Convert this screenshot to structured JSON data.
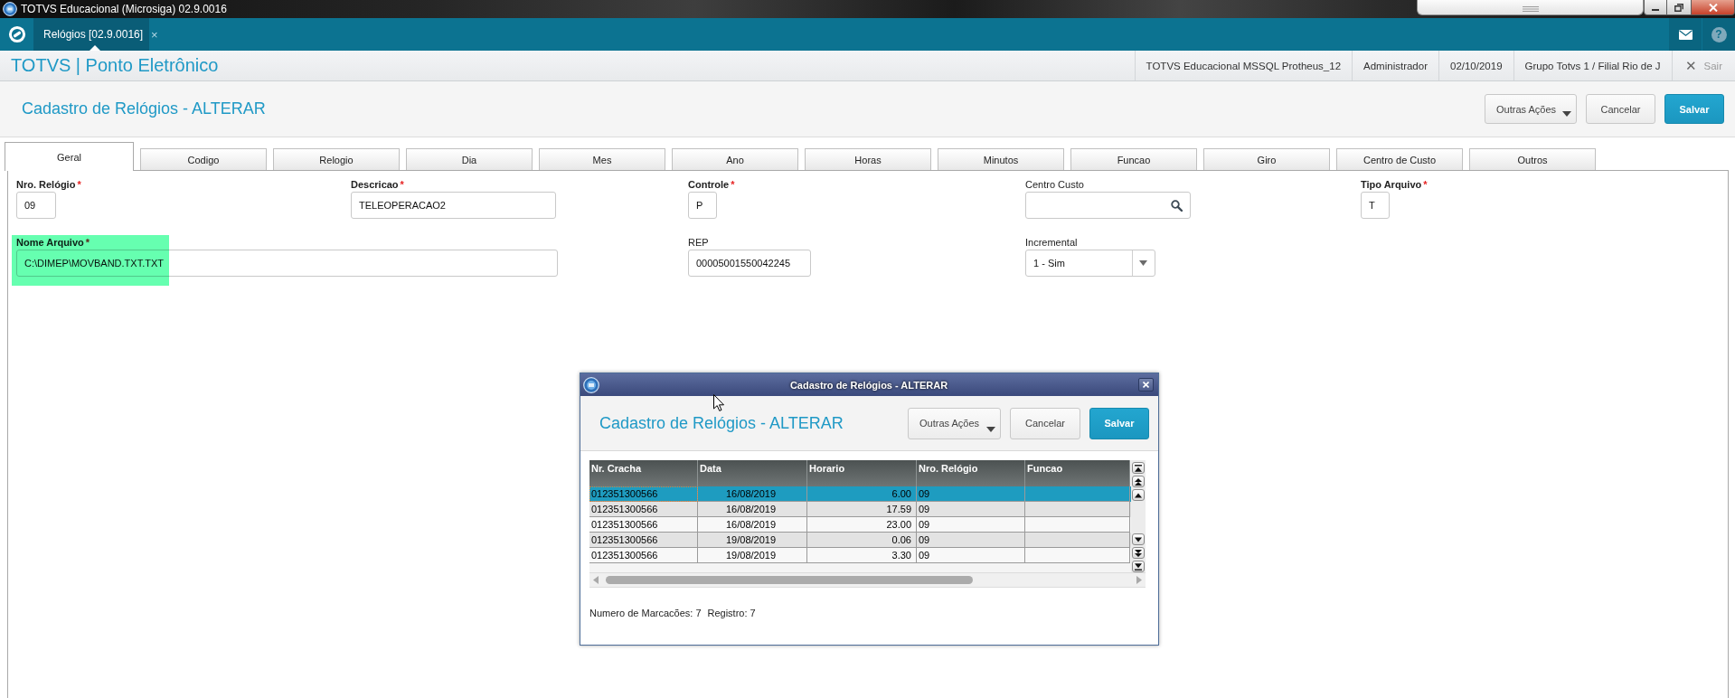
{
  "os_window": {
    "title": "TOTVS Educacional (Microsiga) 02.9.0016"
  },
  "app_bar": {
    "tabs": [
      {
        "label": "Relógios [02.9.0016]",
        "close": "×",
        "selected": true
      }
    ],
    "help": "?"
  },
  "header": {
    "title": "TOTVS | Ponto Eletrônico",
    "info": [
      "TOTVS Educacional MSSQL Protheus_12",
      "Administrador",
      "02/10/2019",
      "Grupo Totvs 1 / Filial Rio de J"
    ],
    "exit": {
      "icon": "✕",
      "label": "Sair"
    }
  },
  "page": {
    "title": "Cadastro de Relógios - ALTERAR",
    "buttons": [
      {
        "label": "Outras Ações",
        "kind": "menu"
      },
      {
        "label": "Cancelar",
        "kind": "default"
      },
      {
        "label": "Salvar",
        "kind": "primary"
      }
    ]
  },
  "tabs": [
    {
      "label": "Geral",
      "selected": true
    },
    {
      "label": "Codigo",
      "selected": false
    },
    {
      "label": "Relogio",
      "selected": false
    },
    {
      "label": "Dia",
      "selected": false
    },
    {
      "label": "Mes",
      "selected": false
    },
    {
      "label": "Ano",
      "selected": false
    },
    {
      "label": "Horas",
      "selected": false
    },
    {
      "label": "Minutos",
      "selected": false
    },
    {
      "label": "Funcao",
      "selected": false
    },
    {
      "label": "Giro",
      "selected": false
    },
    {
      "label": "Centro de Custo",
      "selected": false
    },
    {
      "label": "Outros",
      "selected": false
    }
  ],
  "form": {
    "fields": [
      {
        "label": "Nro. Relógio",
        "required": true,
        "mark": "*",
        "kind": "text",
        "value": "09",
        "highlighted": false
      },
      {
        "label": "Descricao",
        "required": true,
        "mark": "*",
        "kind": "text",
        "value": "TELEOPERACAO2",
        "highlighted": false
      },
      {
        "label": "Controle",
        "required": true,
        "mark": "*",
        "kind": "text",
        "value": "P",
        "highlighted": false
      },
      {
        "label": "Centro Custo",
        "required": false,
        "kind": "lookup",
        "highlighted": false
      },
      {
        "label": "Tipo Arquivo",
        "required": true,
        "mark": "*",
        "kind": "text",
        "value": "T",
        "highlighted": false
      },
      {
        "label": "Nome Arquivo",
        "required": true,
        "mark": "*",
        "kind": "text",
        "value": "C:\\DIMEP\\MOVBAND.TXT.TXT",
        "highlighted": true
      },
      {
        "label": "REP",
        "required": false,
        "kind": "text",
        "value": "00005001550042245",
        "highlighted": false
      },
      {
        "label": "Incremental",
        "required": false,
        "kind": "select",
        "value": "1 - Sim",
        "highlighted": false
      }
    ]
  },
  "dialog": {
    "window_title": "Cadastro de Relógios - ALTERAR",
    "title": "Cadastro de Relógios - ALTERAR",
    "buttons": [
      {
        "label": "Outras Ações",
        "kind": "menu"
      },
      {
        "label": "Cancelar",
        "kind": "default"
      },
      {
        "label": "Salvar",
        "kind": "primary"
      }
    ],
    "grid": {
      "columns": [
        {
          "label": "Nr. Cracha",
          "kind": "text"
        },
        {
          "label": "Data",
          "kind": "date"
        },
        {
          "label": "Horario",
          "kind": "number"
        },
        {
          "label": "Nro. Relógio",
          "kind": "text"
        },
        {
          "label": "Funcao",
          "kind": "text"
        }
      ],
      "rows": [
        {
          "cells": [
            "012351300566",
            "16/08/2019",
            "6.00",
            "09"
          ],
          "selected": true
        },
        {
          "cells": [
            "012351300566",
            "16/08/2019",
            "17.59",
            "09"
          ],
          "selected": false
        },
        {
          "cells": [
            "012351300566",
            "16/08/2019",
            "23.00",
            "09"
          ],
          "selected": false
        },
        {
          "cells": [
            "012351300566",
            "19/08/2019",
            "0.06",
            "09"
          ],
          "selected": false
        },
        {
          "cells": [
            "012351300566",
            "19/08/2019",
            "3.30",
            "09"
          ],
          "selected": false
        }
      ]
    },
    "footer": [
      "Numero de Marcacões: 7",
      "Registro: 7"
    ]
  }
}
